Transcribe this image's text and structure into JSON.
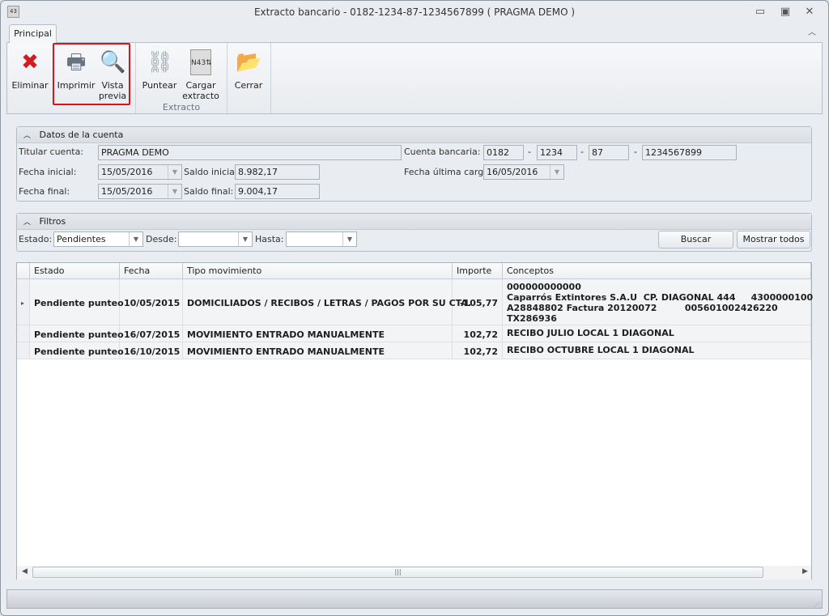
{
  "window": {
    "title": "Extracto bancario - 0182-1234-87-1234567899 ( PRAGMA DEMO                )",
    "app_icon": "43"
  },
  "tabs": [
    {
      "label": "Principal"
    }
  ],
  "ribbon": {
    "eliminar": "Eliminar",
    "imprimir": "Imprimir",
    "vista1": "Vista",
    "vista2": "previa",
    "puntear": "Puntear",
    "cargar1": "Cargar",
    "cargar2": "extracto",
    "cerrar": "Cerrar",
    "group_extracto": "Extracto"
  },
  "datos": {
    "title": "Datos de la cuenta",
    "titular_label": "Titular cuenta:",
    "titular": "PRAGMA DEMO",
    "fi_label": "Fecha inicial:",
    "fi": "15/05/2016",
    "si_label": "Saldo inicial:",
    "si": "8.982,17",
    "ff_label": "Fecha final:",
    "ff": "15/05/2016",
    "sf_label": "Saldo final:",
    "sf": "9.004,17",
    "cuenta_label": "Cuenta bancaria:",
    "c1": "0182",
    "c2": "1234",
    "c3": "87",
    "c4": "1234567899",
    "dash": "-",
    "fuc_label": "Fecha última carga:",
    "fuc": "16/05/2016"
  },
  "filtros": {
    "title": "Filtros",
    "estado_label": "Estado:",
    "estado": "Pendientes",
    "desde_label": "Desde:",
    "desde": "",
    "hasta_label": "Hasta:",
    "hasta": "",
    "buscar": "Buscar",
    "mostrar": "Mostrar todos"
  },
  "grid": {
    "columns": [
      "Estado",
      "Fecha",
      "Tipo movimiento",
      "Importe",
      "Conceptos"
    ],
    "rows": [
      {
        "estado": "Pendiente punteo",
        "fecha": "10/05/2015",
        "tipo": "DOMICILIADOS / RECIBOS / LETRAS / PAGOS POR SU CTA.",
        "importe": "-105,77",
        "conceptos": "000000000000\nCaparrós Extintores S.A.U  CP. DIAGONAL 444     4300000100\nA28848802 Factura 20120072         005601002426220\nTX286936"
      },
      {
        "estado": "Pendiente punteo",
        "fecha": "16/07/2015",
        "tipo": "MOVIMIENTO ENTRADO MANUALMENTE",
        "importe": "102,72",
        "conceptos": "RECIBO JULIO LOCAL 1 DIAGONAL"
      },
      {
        "estado": "Pendiente punteo",
        "fecha": "16/10/2015",
        "tipo": "MOVIMIENTO ENTRADO MANUALMENTE",
        "importe": "102,72",
        "conceptos": "RECIBO OCTUBRE LOCAL 1 DIAGONAL"
      }
    ]
  }
}
